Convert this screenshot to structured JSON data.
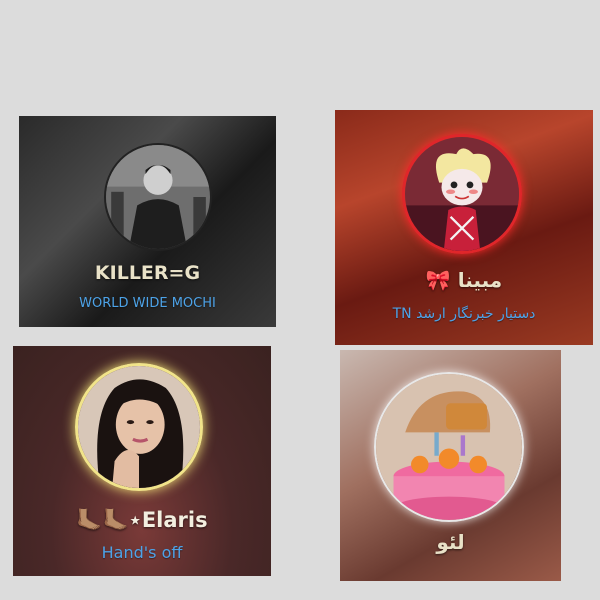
{
  "cards": [
    {
      "name": "KILLER=G",
      "subtitle": "WORLD WIDE MOCHI",
      "avatar": "portrait-photo-bw",
      "ring_color": "#222222"
    },
    {
      "name": "مبینا 🎀",
      "subtitle": "دستیار خبرنگار ارشد TN",
      "avatar": "cartoon-character-avatar",
      "ring_color": "#e0262a"
    },
    {
      "name": "🦶🏽🦶🏽⋆Elaris",
      "subtitle": "Hand's off",
      "avatar": "portrait-photo-woman",
      "ring_color": "#f1e48a"
    },
    {
      "name": "لئو",
      "subtitle": "",
      "avatar": "birthday-cake-illustration",
      "ring_color": "#e8e8e8"
    }
  ]
}
